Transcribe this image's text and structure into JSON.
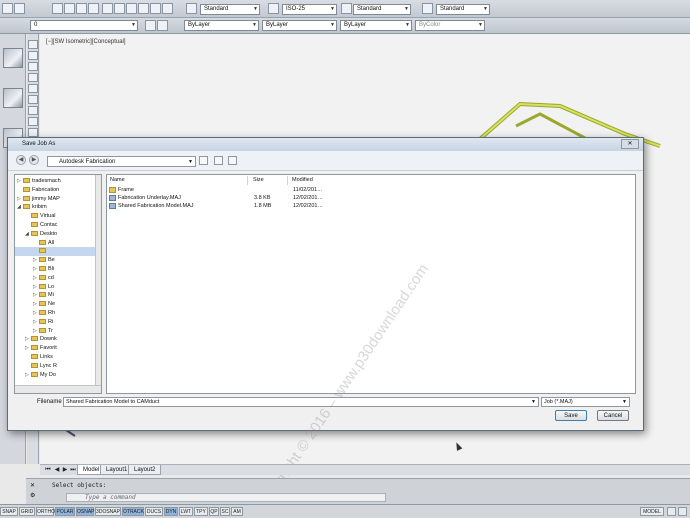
{
  "toolbar": {
    "layer_value": "0",
    "text_style": "Standard",
    "dim_style": "ISO-25",
    "table_style": "Standard",
    "mleader_style": "Standard",
    "color": "ByLayer",
    "linetype": "ByLayer",
    "lineweight": "ByLayer",
    "plotstyle": "ByColor"
  },
  "viewport": {
    "label": "[−][SW Isometric][Conceptual]"
  },
  "dialog": {
    "title": "Save Job As",
    "address": "Autodesk Fabrication",
    "close_label": "✕",
    "columns": {
      "name": "Name",
      "size": "Size",
      "modified": "Modified"
    },
    "files": [
      {
        "name": "Frame",
        "size": "",
        "modified": "11/02/201…",
        "kind": "folder"
      },
      {
        "name": "Fabrication Underlay.MAJ",
        "size": "3.8 KB",
        "modified": "12/02/201…",
        "kind": "job"
      },
      {
        "name": "Shared Fabrication Model.MAJ",
        "size": "1.8 MB",
        "modified": "12/02/201…",
        "kind": "job"
      }
    ],
    "tree": [
      {
        "label": "tradesmach",
        "indent": 0,
        "arrow": "▷"
      },
      {
        "label": "Fabrication",
        "indent": 0,
        "arrow": ""
      },
      {
        "label": "jimmy MAP",
        "indent": 0,
        "arrow": "▷"
      },
      {
        "label": "kribim",
        "indent": 0,
        "arrow": "◢"
      },
      {
        "label": "Virtual",
        "indent": 1,
        "arrow": ""
      },
      {
        "label": "Contac",
        "indent": 1,
        "arrow": ""
      },
      {
        "label": "Deskto",
        "indent": 1,
        "arrow": "◢"
      },
      {
        "label": "All",
        "indent": 2,
        "arrow": ""
      },
      {
        "label": "",
        "indent": 2,
        "arrow": "",
        "selected": true
      },
      {
        "label": "Be",
        "indent": 2,
        "arrow": "▷"
      },
      {
        "label": "Bli",
        "indent": 2,
        "arrow": "▷"
      },
      {
        "label": "cd",
        "indent": 2,
        "arrow": "▷"
      },
      {
        "label": "Lo",
        "indent": 2,
        "arrow": "▷"
      },
      {
        "label": "Mi",
        "indent": 2,
        "arrow": "▷"
      },
      {
        "label": "Ne",
        "indent": 2,
        "arrow": "▷"
      },
      {
        "label": "Rh",
        "indent": 2,
        "arrow": "▷"
      },
      {
        "label": "Ri",
        "indent": 2,
        "arrow": "▷"
      },
      {
        "label": "Tr",
        "indent": 2,
        "arrow": "▷"
      },
      {
        "label": "Downk",
        "indent": 1,
        "arrow": "▷"
      },
      {
        "label": "Favorit",
        "indent": 1,
        "arrow": "▷"
      },
      {
        "label": "Links",
        "indent": 1,
        "arrow": ""
      },
      {
        "label": "Lync R",
        "indent": 1,
        "arrow": ""
      },
      {
        "label": "My Do",
        "indent": 1,
        "arrow": "▷"
      }
    ],
    "filename_label": "Filename",
    "filename_value": "Shared Fabrication Model to CAMduct",
    "filetype": "Job (*.MAJ)",
    "save_label": "Save",
    "cancel_label": "Cancel"
  },
  "watermark": "Copyright © 2016 – www.p30download.com",
  "tabs": {
    "model": "Model",
    "layout1": "Layout1",
    "layout2": "Layout2"
  },
  "command": {
    "history": "Select objects:",
    "placeholder": "Type a command"
  },
  "status": {
    "toggles": [
      "SNAP",
      "GRID",
      "ORTHO",
      "POLAR",
      "OSNAP",
      "3DOSNAP",
      "OTRACK",
      "DUCS",
      "DYN",
      "LWT",
      "TPY",
      "QP",
      "SC",
      "AM"
    ],
    "space": "MODEL"
  }
}
